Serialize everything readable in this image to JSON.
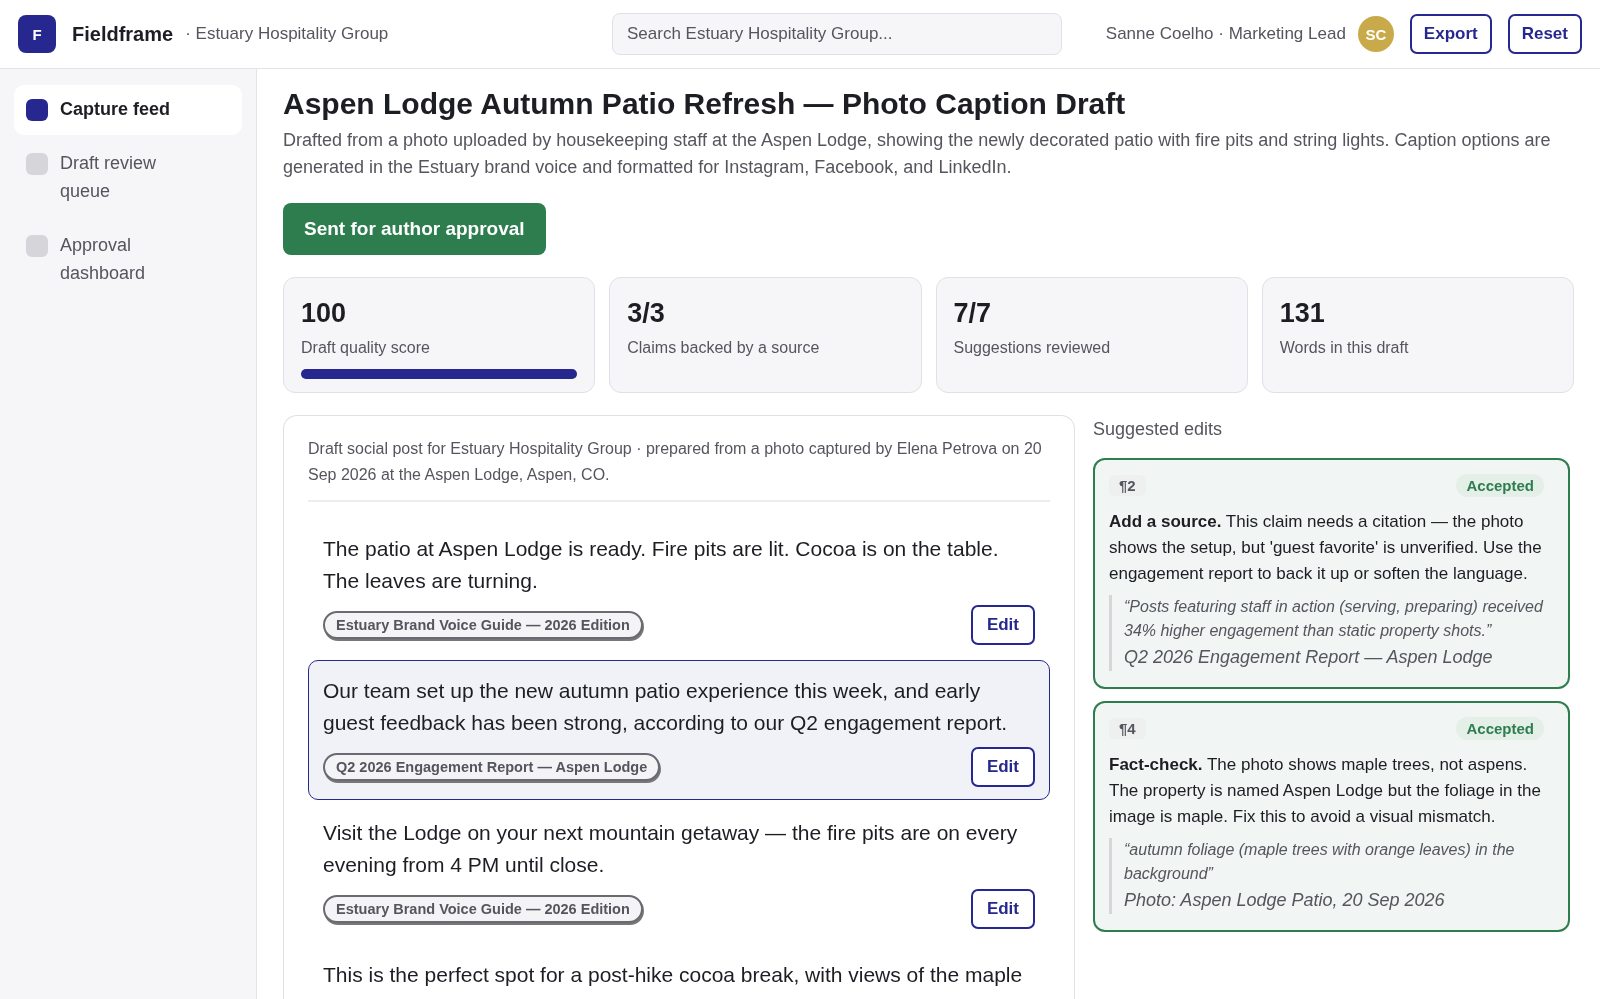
{
  "app": {
    "logo": "F",
    "name": "Fieldframe",
    "org": "· Estuary Hospitality Group"
  },
  "search": {
    "placeholder": "Search Estuary Hospitality Group..."
  },
  "user": {
    "name": "Sanne Coelho · Marketing Lead",
    "initials": "SC"
  },
  "header_buttons": [
    "Export",
    "Reset"
  ],
  "sidebar": {
    "items": [
      {
        "label": "Capture feed",
        "selected": true
      },
      {
        "label": "Draft review queue",
        "selected": false
      },
      {
        "label": "Approval dashboard",
        "selected": false
      }
    ]
  },
  "page": {
    "title": "Aspen Lodge Autumn Patio Refresh — Photo Caption Draft",
    "description": "Drafted from a photo uploaded by housekeeping staff at the Aspen Lodge, showing the newly decorated patio with fire pits and string lights. Caption options are generated in the Estuary brand voice and formatted for Instagram, Facebook, and LinkedIn.",
    "status_button": "Sent for author approval"
  },
  "stats": [
    {
      "value": "100",
      "label": "Draft quality score",
      "level": 1.0
    },
    {
      "value": "3/3",
      "label": "Claims backed by a source"
    },
    {
      "value": "7/7",
      "label": "Suggestions reviewed"
    },
    {
      "value": "131",
      "label": "Words in this draft"
    }
  ],
  "draft": {
    "meta": "Draft social post for Estuary Hospitality Group · prepared from a photo captured by Elena Petrova on 20 Sep 2026 at the Aspen Lodge, Aspen, CO.",
    "paragraphs": [
      {
        "text": "The patio at Aspen Lodge is ready. Fire pits are lit. Cocoa is on the table. The leaves are turning.",
        "source": "Estuary Brand Voice Guide — 2026 Edition",
        "edit": "Edit",
        "selected": false
      },
      {
        "text": "Our team set up the new autumn patio experience this week, and early guest feedback has been strong, according to our Q2 engagement report.",
        "source": "Q2 2026 Engagement Report — Aspen Lodge",
        "edit": "Edit",
        "selected": true
      },
      {
        "text": "Visit the Lodge on your next mountain getaway — the fire pits are on every evening from 4 PM until close.",
        "source": "Estuary Brand Voice Guide — 2026 Edition",
        "edit": "Edit",
        "selected": false
      },
      {
        "text": "This is the perfect spot for a post-hike cocoa break, with views of the maple",
        "selected": false
      }
    ]
  },
  "suggestions": {
    "title": "Suggested edits",
    "items": [
      {
        "paragraph": "¶2",
        "status": "Accepted",
        "text": "**Add a source.** This claim needs a citation — the photo shows the setup, but 'guest favorite' is unverified. Use the engagement report to back it up or soften the language.",
        "quote": "“Posts featuring staff in action (serving, preparing) received 34% higher engagement than static property shots.”",
        "source": "Q2 2026 Engagement Report — Aspen Lodge"
      },
      {
        "paragraph": "¶4",
        "status": "Accepted",
        "text": "**Fact-check.** The photo shows maple trees, not aspens. The property is named Aspen Lodge but the foliage in the image is maple. Fix this to avoid a visual mismatch.",
        "quote": "“autumn foliage (maple trees with orange leaves) in the background”",
        "source": "Photo: Aspen Lodge Patio, 20 Sep 2026"
      }
    ]
  }
}
